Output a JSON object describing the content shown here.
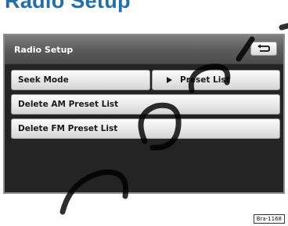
{
  "page": {
    "title": "Radio Setup",
    "figure_code": "Bra-1168"
  },
  "screen": {
    "header": {
      "title": "Radio Setup",
      "back_icon": "return-arrow-icon"
    },
    "rows": [
      {
        "label": "Seek Mode",
        "value": "Preset List",
        "value_icon": "triangle-right-icon"
      },
      {
        "label": "Delete AM Preset List"
      },
      {
        "label": "Delete FM Preset List"
      }
    ]
  },
  "colors": {
    "title_blue": "#1f6fb0",
    "screen_bg": "#242424",
    "button_face": "#e6e6e6"
  }
}
